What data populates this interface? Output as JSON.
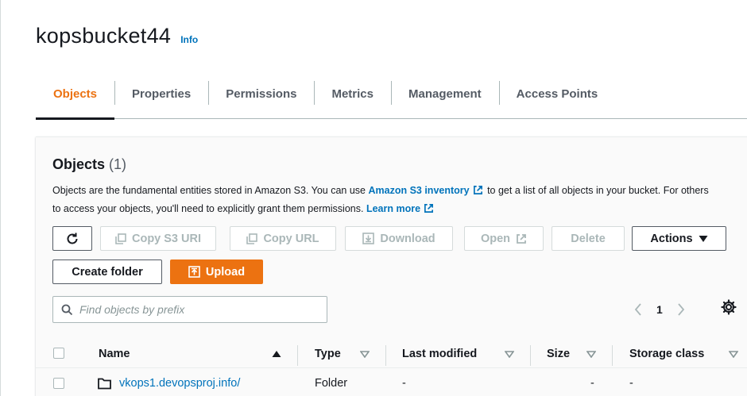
{
  "header": {
    "bucket_name": "kopsbucket44",
    "info_label": "Info"
  },
  "tabs": [
    {
      "label": "Objects",
      "active": true
    },
    {
      "label": "Properties",
      "active": false
    },
    {
      "label": "Permissions",
      "active": false
    },
    {
      "label": "Metrics",
      "active": false
    },
    {
      "label": "Management",
      "active": false
    },
    {
      "label": "Access Points",
      "active": false
    }
  ],
  "objects_panel": {
    "heading": "Objects",
    "count": "(1)",
    "description": {
      "part1": "Objects are the fundamental entities stored in Amazon S3. You can use ",
      "link1": "Amazon S3 inventory",
      "part2": " to get a list of all objects in your bucket. For others to access your objects, you'll need to explicitly grant them permissions. ",
      "link2": "Learn more"
    }
  },
  "toolbar": {
    "refresh_icon": "refresh-icon",
    "copy_s3_uri": "Copy S3 URI",
    "copy_url": "Copy URL",
    "download": "Download",
    "open": "Open",
    "delete": "Delete",
    "actions": "Actions",
    "create_folder": "Create folder",
    "upload": "Upload"
  },
  "search": {
    "placeholder": "Find objects by prefix",
    "value": ""
  },
  "pagination": {
    "current_page": "1"
  },
  "table": {
    "columns": [
      "Name",
      "Type",
      "Last modified",
      "Size",
      "Storage class"
    ],
    "rows": [
      {
        "name": "vkops1.devopsproj.info/",
        "type": "Folder",
        "last_modified": "-",
        "size": "-",
        "storage_class": "-"
      }
    ]
  },
  "colors": {
    "accent": "#ec7211",
    "link": "#0073bb",
    "text": "#16191f",
    "muted": "#545b64",
    "disabled": "#aab7b8"
  }
}
